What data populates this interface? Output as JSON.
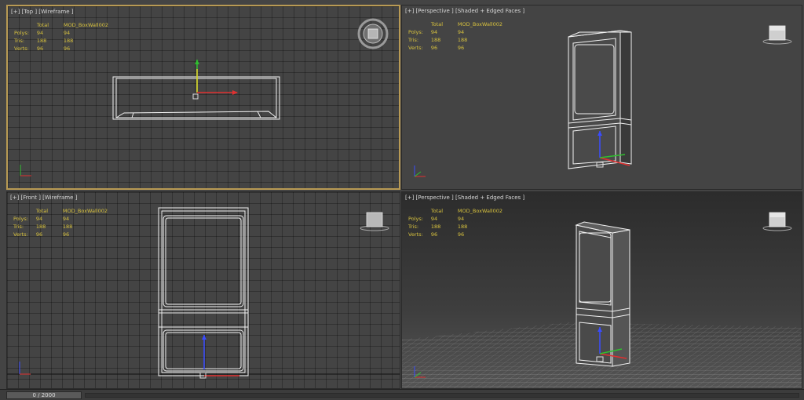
{
  "viewports": [
    {
      "label": "[+] [Top ] [Wireframe ]",
      "stats": {
        "header": [
          "",
          "Total",
          "MOD_BoxWall002"
        ],
        "rows": [
          [
            "Polys:",
            "94",
            "94"
          ],
          [
            "Tris:",
            "188",
            "188"
          ],
          [
            "Verts:",
            "96",
            "96"
          ]
        ]
      }
    },
    {
      "label": "[+] [Perspective ] [Shaded + Edged Faces ]",
      "stats": {
        "header": [
          "",
          "Total",
          "MOD_BoxWall002"
        ],
        "rows": [
          [
            "Polys:",
            "94",
            "94"
          ],
          [
            "Tris:",
            "188",
            "188"
          ],
          [
            "Verts:",
            "96",
            "96"
          ]
        ]
      }
    },
    {
      "label": "[+] [Front ] [Wireframe ]",
      "stats": {
        "header": [
          "",
          "Total",
          "MOD_BoxWall002"
        ],
        "rows": [
          [
            "Polys:",
            "94",
            "94"
          ],
          [
            "Tris:",
            "188",
            "188"
          ],
          [
            "Verts:",
            "96",
            "96"
          ]
        ]
      }
    },
    {
      "label": "[+] [Perspective ] [Shaded + Edged Faces ]",
      "stats": {
        "header": [
          "",
          "Total",
          "MOD_BoxWall002"
        ],
        "rows": [
          [
            "Polys:",
            "94",
            "94"
          ],
          [
            "Tris:",
            "188",
            "188"
          ],
          [
            "Verts:",
            "96",
            "96"
          ]
        ]
      }
    }
  ],
  "timeline": {
    "frame_readout": "0 / 2000"
  },
  "colors": {
    "axis_x": "#e03030",
    "axis_y": "#2fbf2f",
    "axis_z": "#3a4cff",
    "gizmo_y": "#e8d22c",
    "active_border": "#b89a54",
    "stats_text": "#d8c23e"
  }
}
